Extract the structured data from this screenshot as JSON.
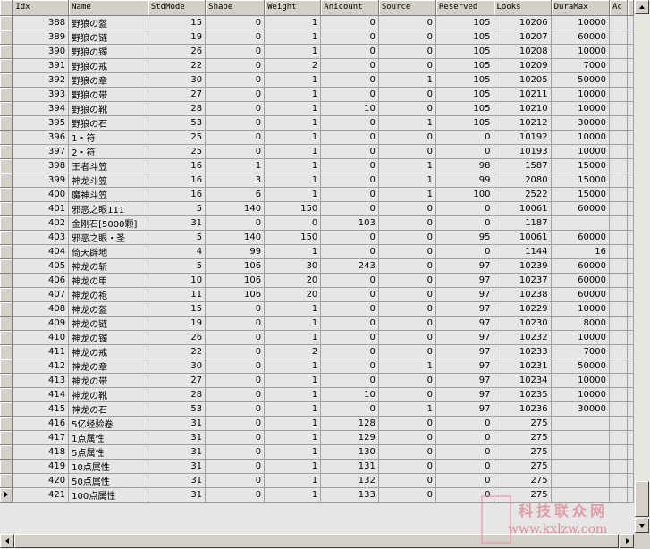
{
  "columns": [
    "Idx",
    "Name",
    "StdMode",
    "Shape",
    "Weight",
    "Anicount",
    "Source",
    "Reserved",
    "Looks",
    "DuraMax",
    "Ac"
  ],
  "rows": [
    [
      "388",
      "野狼の盔",
      "15",
      "0",
      "1",
      "0",
      "0",
      "105",
      "10206",
      "10000",
      ""
    ],
    [
      "389",
      "野狼の链",
      "19",
      "0",
      "1",
      "0",
      "0",
      "105",
      "10207",
      "60000",
      ""
    ],
    [
      "390",
      "野狼の镯",
      "26",
      "0",
      "1",
      "0",
      "0",
      "105",
      "10208",
      "10000",
      ""
    ],
    [
      "391",
      "野狼の戒",
      "22",
      "0",
      "2",
      "0",
      "0",
      "105",
      "10209",
      "7000",
      ""
    ],
    [
      "392",
      "野狼の章",
      "30",
      "0",
      "1",
      "0",
      "1",
      "105",
      "10205",
      "50000",
      ""
    ],
    [
      "393",
      "野狼の带",
      "27",
      "0",
      "1",
      "0",
      "0",
      "105",
      "10211",
      "10000",
      ""
    ],
    [
      "394",
      "野狼の靴",
      "28",
      "0",
      "1",
      "10",
      "0",
      "105",
      "10210",
      "10000",
      ""
    ],
    [
      "395",
      "野狼の石",
      "53",
      "0",
      "1",
      "0",
      "1",
      "105",
      "10212",
      "30000",
      ""
    ],
    [
      "396",
      "1・符",
      "25",
      "0",
      "1",
      "0",
      "0",
      "0",
      "10192",
      "10000",
      ""
    ],
    [
      "397",
      "2・符",
      "25",
      "0",
      "1",
      "0",
      "0",
      "0",
      "10193",
      "10000",
      ""
    ],
    [
      "398",
      "王者斗笠",
      "16",
      "1",
      "1",
      "0",
      "1",
      "98",
      "1587",
      "15000",
      ""
    ],
    [
      "399",
      "神龙斗笠",
      "16",
      "3",
      "1",
      "0",
      "1",
      "99",
      "2080",
      "15000",
      ""
    ],
    [
      "400",
      "魔神斗笠",
      "16",
      "6",
      "1",
      "0",
      "1",
      "100",
      "2522",
      "15000",
      ""
    ],
    [
      "401",
      "邪恶之眼111",
      "5",
      "140",
      "150",
      "0",
      "0",
      "0",
      "10061",
      "60000",
      ""
    ],
    [
      "402",
      "金刚石[5000颗]",
      "31",
      "0",
      "0",
      "103",
      "0",
      "0",
      "1187",
      "",
      ""
    ],
    [
      "403",
      "邪恶之眼・圣",
      "5",
      "140",
      "150",
      "0",
      "0",
      "95",
      "10061",
      "60000",
      ""
    ],
    [
      "404",
      "倚天辟地",
      "4",
      "99",
      "1",
      "0",
      "0",
      "0",
      "1144",
      "16",
      ""
    ],
    [
      "405",
      "神龙の斩",
      "5",
      "106",
      "30",
      "243",
      "0",
      "97",
      "10239",
      "60000",
      ""
    ],
    [
      "406",
      "神龙の甲",
      "10",
      "106",
      "20",
      "0",
      "0",
      "97",
      "10237",
      "60000",
      ""
    ],
    [
      "407",
      "神龙の袍",
      "11",
      "106",
      "20",
      "0",
      "0",
      "97",
      "10238",
      "60000",
      ""
    ],
    [
      "408",
      "神龙の盔",
      "15",
      "0",
      "1",
      "0",
      "0",
      "97",
      "10229",
      "10000",
      ""
    ],
    [
      "409",
      "神龙の链",
      "19",
      "0",
      "1",
      "0",
      "0",
      "97",
      "10230",
      "8000",
      ""
    ],
    [
      "410",
      "神龙の镯",
      "26",
      "0",
      "1",
      "0",
      "0",
      "97",
      "10232",
      "10000",
      ""
    ],
    [
      "411",
      "神龙の戒",
      "22",
      "0",
      "2",
      "0",
      "0",
      "97",
      "10233",
      "7000",
      ""
    ],
    [
      "412",
      "神龙の章",
      "30",
      "0",
      "1",
      "0",
      "1",
      "97",
      "10231",
      "50000",
      ""
    ],
    [
      "413",
      "神龙の带",
      "27",
      "0",
      "1",
      "0",
      "0",
      "97",
      "10234",
      "10000",
      ""
    ],
    [
      "414",
      "神龙の靴",
      "28",
      "0",
      "1",
      "10",
      "0",
      "97",
      "10235",
      "10000",
      ""
    ],
    [
      "415",
      "神龙の石",
      "53",
      "0",
      "1",
      "0",
      "1",
      "97",
      "10236",
      "30000",
      ""
    ],
    [
      "416",
      "5亿经验卷",
      "31",
      "0",
      "1",
      "128",
      "0",
      "0",
      "275",
      "",
      ""
    ],
    [
      "417",
      "1点属性",
      "31",
      "0",
      "1",
      "129",
      "0",
      "0",
      "275",
      "",
      ""
    ],
    [
      "418",
      "5点属性",
      "31",
      "0",
      "1",
      "130",
      "0",
      "0",
      "275",
      "",
      ""
    ],
    [
      "419",
      "10点属性",
      "31",
      "0",
      "1",
      "131",
      "0",
      "0",
      "275",
      "",
      ""
    ],
    [
      "420",
      "50点属性",
      "31",
      "0",
      "1",
      "132",
      "0",
      "0",
      "275",
      "",
      ""
    ],
    [
      "421",
      "100点属性",
      "31",
      "0",
      "1",
      "133",
      "0",
      "0",
      "275",
      "",
      ""
    ]
  ],
  "current_row_index": 33,
  "watermark": {
    "line1": "科技联众网",
    "line2": "www.kxlzw.com"
  }
}
